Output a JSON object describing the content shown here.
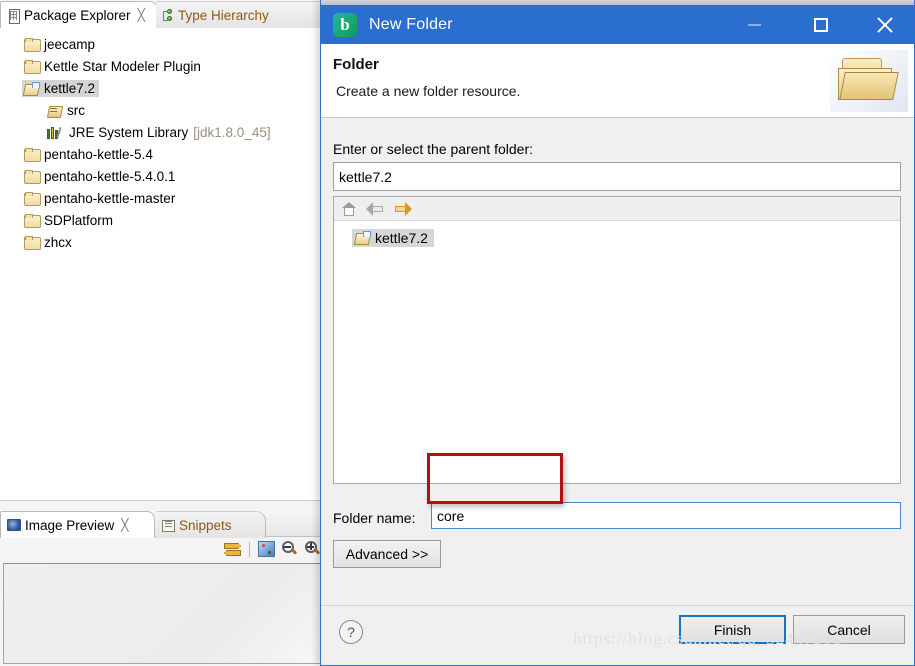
{
  "ide": {
    "tabs": [
      {
        "label": "Package Explorer",
        "icon": "package-explorer-icon",
        "closable": true,
        "active": true
      },
      {
        "label": "Type Hierarchy",
        "icon": "type-hierarchy-icon",
        "closable": false,
        "active": false
      }
    ],
    "tree": [
      {
        "label": "jeecamp",
        "icon": "folder-icon",
        "indent": false,
        "selected": false
      },
      {
        "label": "Kettle Star Modeler Plugin",
        "icon": "folder-icon",
        "indent": false,
        "selected": false
      },
      {
        "label": "kettle7.2",
        "icon": "open-project-icon",
        "indent": false,
        "selected": true
      },
      {
        "label": "src",
        "icon": "source-package-icon",
        "indent": true,
        "selected": false
      },
      {
        "label": "JRE System Library",
        "dim": "[jdk1.8.0_45]",
        "icon": "jre-library-icon",
        "indent": true,
        "selected": false
      },
      {
        "label": "pentaho-kettle-5.4",
        "icon": "folder-icon",
        "indent": false,
        "selected": false
      },
      {
        "label": "pentaho-kettle-5.4.0.1",
        "icon": "folder-icon",
        "indent": false,
        "selected": false
      },
      {
        "label": "pentaho-kettle-master",
        "icon": "folder-icon",
        "indent": false,
        "selected": false
      },
      {
        "label": "SDPlatform",
        "icon": "folder-icon",
        "indent": false,
        "selected": false
      },
      {
        "label": "zhcx",
        "icon": "folder-icon",
        "indent": false,
        "selected": false
      }
    ],
    "lower_view": {
      "tabs": [
        {
          "label": "Image Preview",
          "icon": "image-preview-icon",
          "closable": true,
          "active": true
        },
        {
          "label": "Snippets",
          "icon": "snippets-icon",
          "closable": false,
          "active": false
        }
      ],
      "toolbar": [
        {
          "name": "synchronize-icon"
        },
        {
          "name": "palette-icon"
        },
        {
          "name": "zoom-out-icon"
        },
        {
          "name": "zoom-in-icon"
        }
      ]
    }
  },
  "dialog": {
    "title": "New Folder",
    "app_icon_letter": "b",
    "window_buttons": {
      "minimize": "–",
      "maximize": "□",
      "close": "✕"
    },
    "header": {
      "title": "Folder",
      "subtitle": "Create a new folder resource.",
      "icon": "folder-graphic-icon"
    },
    "parent_folder": {
      "label": "Enter or select the parent folder:",
      "value": "kettle7.2",
      "placeholder": ""
    },
    "tree_toolbar": [
      {
        "name": "home-icon",
        "enabled": true
      },
      {
        "name": "back-arrow-icon",
        "enabled": false
      },
      {
        "name": "forward-arrow-icon",
        "enabled": true
      }
    ],
    "tree_items": [
      {
        "label": "kettle7.2",
        "icon": "open-project-icon",
        "selected": true
      }
    ],
    "folder_name": {
      "label": "Folder name:",
      "value": "core",
      "placeholder": ""
    },
    "advanced_button": "Advanced >>",
    "help_button": "?",
    "finish_button": "Finish",
    "cancel_button": "Cancel"
  },
  "watermark": "https://blog.csdn.net/qq_32447301",
  "colors": {
    "titlebar_blue": "#2a6fd0",
    "accent_blue": "#1573c8",
    "annotation_red": "#b70f0f",
    "app_icon_green": "#19a86f"
  }
}
